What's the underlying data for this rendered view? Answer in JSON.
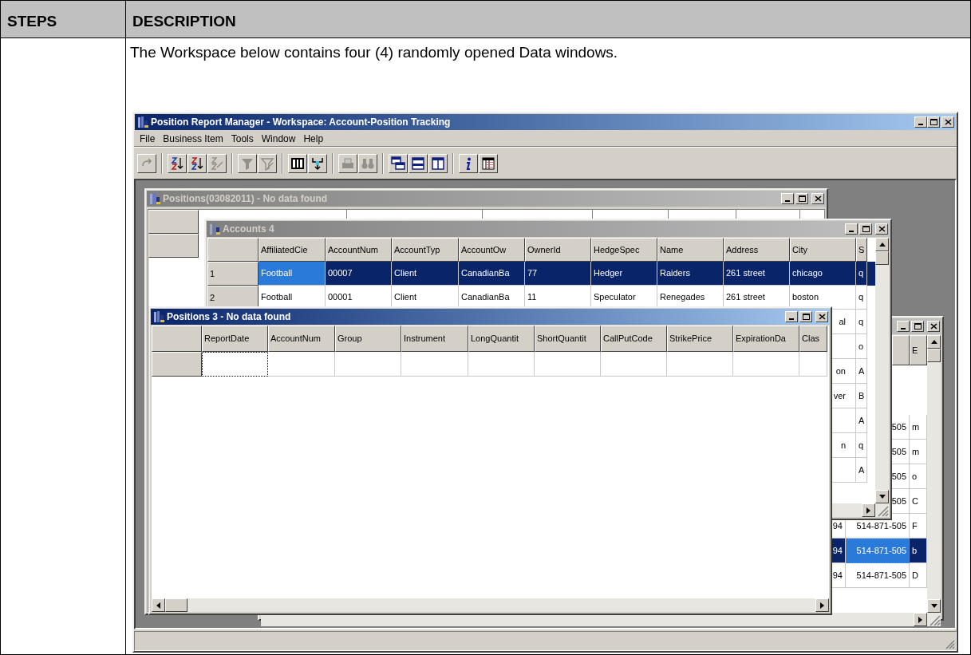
{
  "document": {
    "columns": [
      "STEPS",
      "DESCRIPTION"
    ],
    "description": "The Workspace below contains four (4) randomly opened Data windows."
  },
  "app": {
    "title": "Position Report Manager - Workspace: Account-Position Tracking",
    "menu": [
      "File",
      "Business Item",
      "Tools",
      "Window",
      "Help"
    ],
    "toolbar_groups": [
      [
        {
          "kind": "redo",
          "disabled": true
        }
      ],
      [
        {
          "kind": "sort-asc",
          "disabled": false
        },
        {
          "kind": "sort-desc",
          "disabled": false
        },
        {
          "kind": "clear-sort",
          "disabled": true
        }
      ],
      [
        {
          "kind": "filter",
          "disabled": true
        },
        {
          "kind": "clear-filter",
          "disabled": true
        }
      ],
      [
        {
          "kind": "columns",
          "disabled": false
        },
        {
          "kind": "split",
          "disabled": false
        }
      ],
      [
        {
          "kind": "print",
          "disabled": true
        },
        {
          "kind": "find",
          "disabled": true
        }
      ],
      [
        {
          "kind": "cascade",
          "disabled": false
        },
        {
          "kind": "tile-horizontal",
          "disabled": false
        },
        {
          "kind": "tile-vertical",
          "disabled": false
        }
      ],
      [
        {
          "kind": "info",
          "disabled": false
        },
        {
          "kind": "layout",
          "disabled": false
        }
      ]
    ]
  },
  "positions_window": {
    "title": "Positions(03082011) - No data found",
    "active": false
  },
  "back_window": {
    "active": false,
    "header": [
      "E"
    ],
    "rows": [
      {
        "selected": false
      },
      {
        "selected": false
      },
      {
        "selected": false,
        "phone": "505",
        "column_3": "m"
      },
      {
        "selected": false,
        "phone": "505",
        "column_3": "m"
      },
      {
        "selected": false,
        "phone": "505",
        "column_3": "o"
      },
      {
        "selected": false,
        "phone": "505",
        "column_3": "C"
      },
      {
        "selected": false,
        "column_1": "94",
        "phone": "514-871-505",
        "column_3": "F"
      },
      {
        "selected": true,
        "column_1": "94",
        "phone": "514-871-505",
        "column_3": "b"
      },
      {
        "selected": false,
        "column_1": "94",
        "phone": "514-871-505",
        "column_3": "D"
      },
      {
        "selected": false
      }
    ]
  },
  "accounts_window": {
    "title": "Accounts 4",
    "active": false,
    "columns": [
      "AffiliatedCie",
      "AccountNum",
      "AccountTyp",
      "AccountOw",
      "OwnerId",
      "HedgeSpec",
      "Name",
      "Address",
      "City",
      "S"
    ],
    "rows": [
      {
        "selected": true,
        "row_number": "1",
        "cells": [
          "Football",
          "00007",
          "Client",
          "CanadianBa",
          "77",
          "Hedger",
          "Raiders",
          "261 street",
          "chicago",
          "q"
        ]
      },
      {
        "selected": false,
        "row_number": "2",
        "cells": [
          "Football",
          "00001",
          "Client",
          "CanadianBa",
          "11",
          "Speculator",
          "Renegades",
          "261 street",
          "boston",
          "q"
        ]
      }
    ],
    "partial_rows": [
      {
        "city": "al",
        "column_s": "q"
      },
      {
        "column_s": "o"
      },
      {
        "city": "on",
        "column_s": "A"
      },
      {
        "city": "ver",
        "column_s": "B"
      },
      {
        "column_s": "A"
      },
      {
        "city": "n",
        "column_s": "q"
      },
      {
        "column_s": "A"
      }
    ]
  },
  "positions3_window": {
    "title": "Positions 3 - No data found",
    "active": true,
    "columns": [
      "ReportDate",
      "AccountNum",
      "Group",
      "Instrument",
      "LongQuantit",
      "ShortQuantit",
      "CallPutCode",
      "StrikePrice",
      "ExpirationDa",
      "Clas"
    ]
  }
}
